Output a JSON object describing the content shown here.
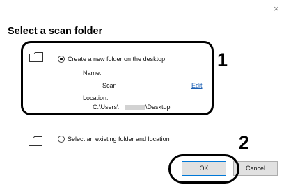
{
  "dialog": {
    "close_glyph": "×",
    "title": "Select a scan folder"
  },
  "option_new": {
    "icon": "folder-icon",
    "label": "Create a new folder on the desktop",
    "selected": true,
    "name_label": "Name:",
    "name_value": "Scan",
    "edit_link": "Edit",
    "location_label": "Location:",
    "location_prefix": "C:\\Users\\",
    "location_suffix": "\\Desktop"
  },
  "option_existing": {
    "icon": "folder-icon",
    "label": "Select an existing folder and location",
    "selected": false
  },
  "buttons": {
    "ok": "OK",
    "cancel": "Cancel"
  },
  "callouts": {
    "one": "1",
    "two": "2"
  }
}
